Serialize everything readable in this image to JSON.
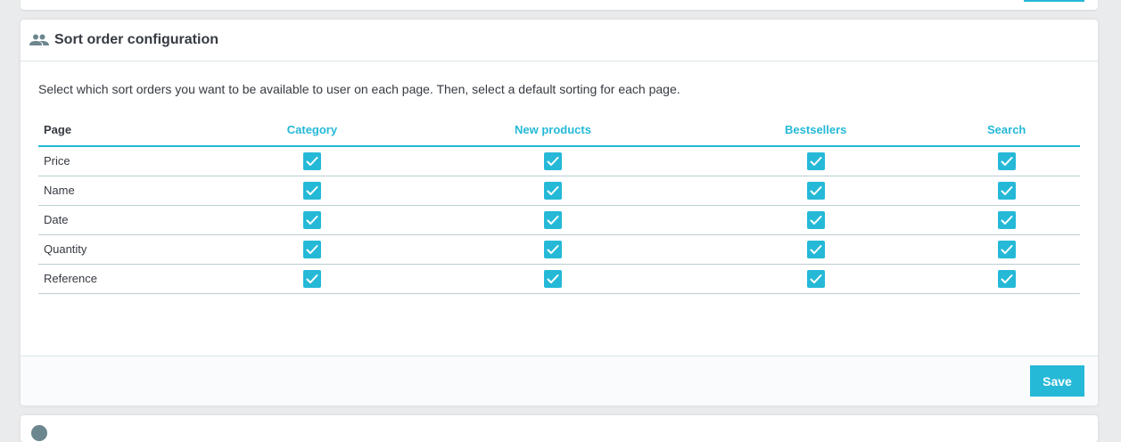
{
  "panel": {
    "title": "Sort order configuration",
    "icon": "users-icon",
    "description": "Select which sort orders you want to be available to user on each page. Then, select a default sorting for each page."
  },
  "table": {
    "headers": [
      "Page",
      "Category",
      "New products",
      "Bestsellers",
      "Search"
    ],
    "rows": [
      {
        "label": "Price",
        "checked": [
          true,
          true,
          true,
          true
        ]
      },
      {
        "label": "Name",
        "checked": [
          true,
          true,
          true,
          true
        ]
      },
      {
        "label": "Date",
        "checked": [
          true,
          true,
          true,
          true
        ]
      },
      {
        "label": "Quantity",
        "checked": [
          true,
          true,
          true,
          true
        ]
      },
      {
        "label": "Reference",
        "checked": [
          true,
          true,
          true,
          true
        ]
      }
    ]
  },
  "footer": {
    "save_label": "Save"
  },
  "colors": {
    "accent": "#25b9d7",
    "text": "#363a41",
    "border": "#bbcdd2"
  }
}
